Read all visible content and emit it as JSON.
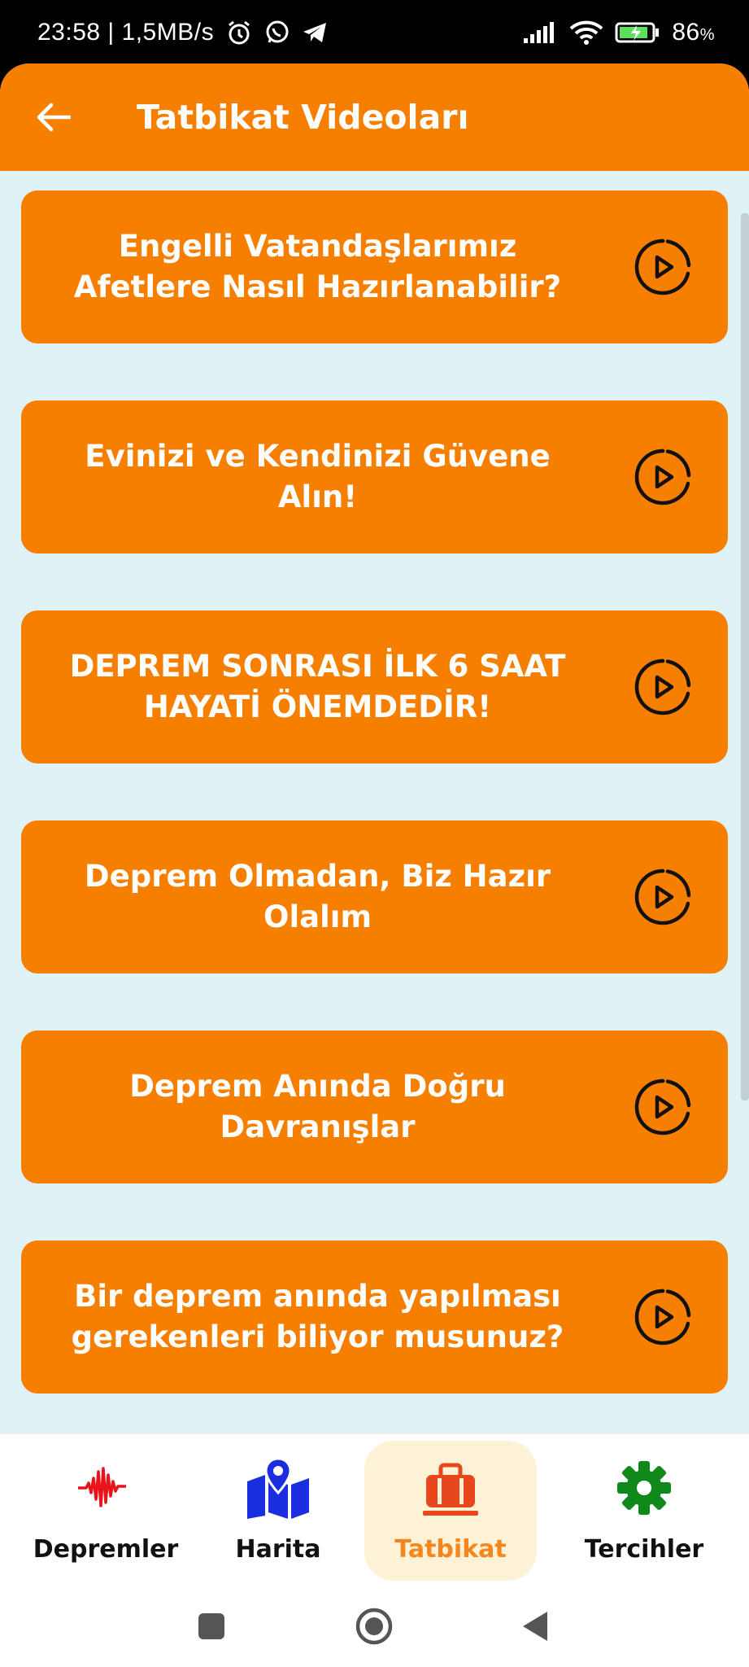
{
  "status": {
    "time_speed": "23:58 | 1,5MB/s",
    "battery": "86"
  },
  "app_bar": {
    "title": "Tatbikat Videoları"
  },
  "videos": [
    {
      "title": "Engelli Vatandaşlarımız Afetlere Nasıl Hazırlanabilir?"
    },
    {
      "title": "Evinizi ve Kendinizi Güvene Alın!"
    },
    {
      "title": "DEPREM SONRASI İLK 6 SAAT HAYATİ ÖNEMDEDİR!"
    },
    {
      "title": "Deprem Olmadan, Biz Hazır Olalım"
    },
    {
      "title": "Deprem Anında Doğru Davranışlar"
    },
    {
      "title": "Bir deprem anında yapılması gerekenleri biliyor musunuz?"
    }
  ],
  "nav": {
    "items": [
      {
        "label": "Depremler",
        "icon": "seismograph-icon"
      },
      {
        "label": "Harita",
        "icon": "map-icon"
      },
      {
        "label": "Tatbikat",
        "icon": "suitcase-icon"
      },
      {
        "label": "Tercihler",
        "icon": "gear-icon"
      }
    ],
    "active": "Tatbikat"
  },
  "colors": {
    "primary": "#f77f00",
    "content_bg": "#dff3f7",
    "active_nav_bg": "#fdf2d6",
    "active_nav_text": "#f5861f",
    "seismo_red": "#e8141c",
    "map_blue": "#1a2ee0",
    "settings_green": "#0f8a1a"
  }
}
